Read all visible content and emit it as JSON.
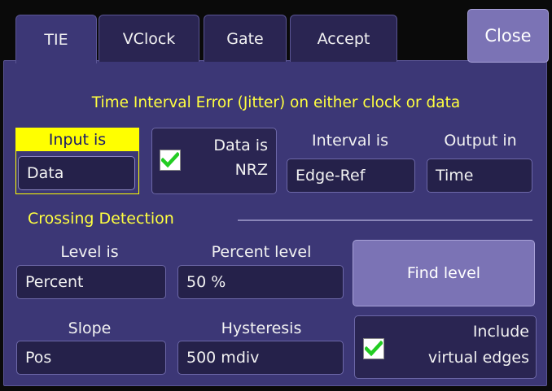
{
  "tabs": [
    {
      "label": "TIE",
      "active": true
    },
    {
      "label": "VClock",
      "active": false
    },
    {
      "label": "Gate",
      "active": false
    },
    {
      "label": "Accept",
      "active": false
    }
  ],
  "close_label": "Close",
  "heading": "Time Interval Error (Jitter) on either clock or data",
  "input": {
    "label": "Input is",
    "value": "Data"
  },
  "data_nrz": {
    "line1": "Data is",
    "line2": "NRZ",
    "checked": true
  },
  "interval": {
    "label": "Interval is",
    "value": "Edge-Ref"
  },
  "output": {
    "label": "Output in",
    "value": "Time"
  },
  "crossing_section": "Crossing Detection",
  "level": {
    "label": "Level is",
    "value": "Percent"
  },
  "percent_level": {
    "label": "Percent level",
    "value": "50 %"
  },
  "find_level_label": "Find level",
  "slope": {
    "label": "Slope",
    "value": "Pos"
  },
  "hysteresis": {
    "label": "Hysteresis",
    "value": "500 mdiv"
  },
  "virtual_edges": {
    "line1": "Include",
    "line2": "virtual edges",
    "checked": true
  },
  "colors": {
    "accent": "#ffff40",
    "panel": "#3c3776",
    "field": "#25214a",
    "button": "#7b73b5",
    "check": "#22cc22"
  }
}
